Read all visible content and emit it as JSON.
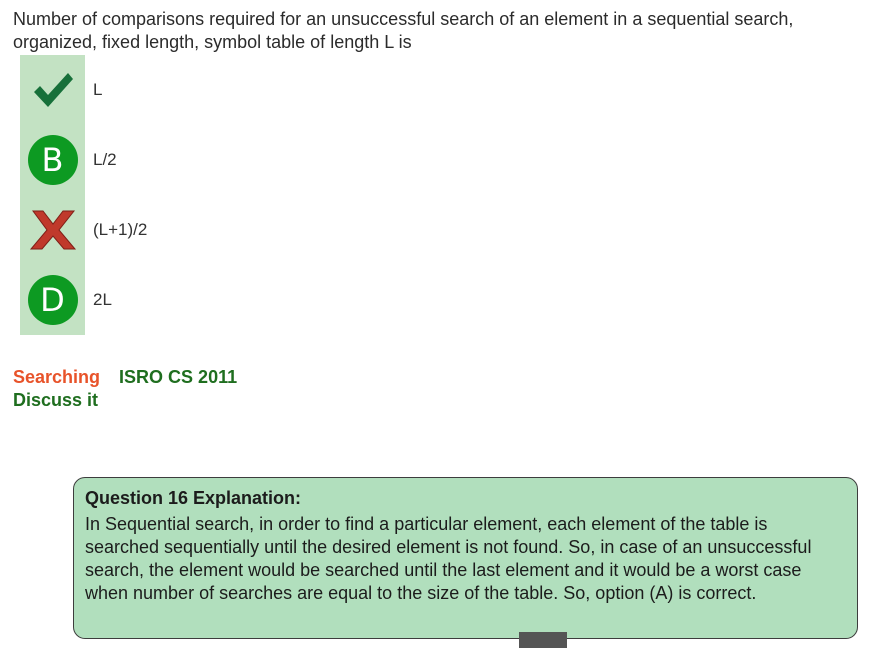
{
  "question": {
    "text": "Number of comparisons required for an unsuccessful search of an element in a sequential search, organized, fixed length, symbol table of length L is"
  },
  "options": [
    {
      "marker": "check-icon",
      "marker_text": "",
      "text": "L"
    },
    {
      "marker": "letter",
      "marker_text": "B",
      "text": "L/2"
    },
    {
      "marker": "cross-icon",
      "marker_text": "",
      "text": "(L+1)/2"
    },
    {
      "marker": "letter",
      "marker_text": "D",
      "text": "2L"
    }
  ],
  "tags": {
    "topic": "Searching",
    "exam": "ISRO CS 2011",
    "discuss": "Discuss it"
  },
  "explanation": {
    "title": "Question 16 Explanation:",
    "body": "In Sequential search, in order to find a particular element, each element of the table is searched sequentially until the desired element is not found. So, in case of an unsuccessful search, the element would be searched until the last element and it would be a worst case when number of searches are equal to the size of the table. So, option (A) is correct."
  },
  "colors": {
    "marker_bg": "#c3e2c3",
    "circle": "#0d9a22",
    "check": "#17703a",
    "cross": "#c0392b",
    "topic": "#e8532a",
    "exam": "#1f6e1f",
    "explanation_bg": "#b1dfbd"
  }
}
